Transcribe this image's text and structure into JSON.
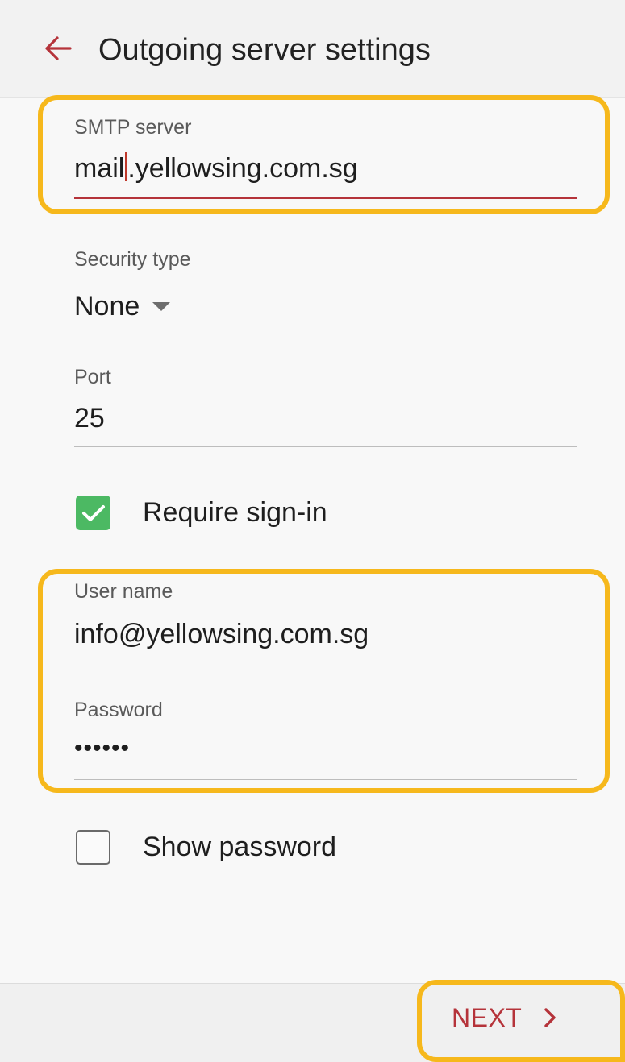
{
  "header": {
    "title": "Outgoing server settings",
    "back_icon": "arrow-left-icon"
  },
  "smtp": {
    "label": "SMTP server",
    "value_before_cursor": "mail",
    "value_after_cursor": ".yellowsing.com.sg"
  },
  "security": {
    "label": "Security type",
    "selected": "None"
  },
  "port": {
    "label": "Port",
    "value": "25"
  },
  "require_signin": {
    "label": "Require sign-in",
    "checked": true
  },
  "username": {
    "label": "User name",
    "value": "info@yellowsing.com.sg"
  },
  "password": {
    "label": "Password",
    "value": "••••••"
  },
  "show_password": {
    "label": "Show password",
    "checked": false
  },
  "footer": {
    "next_label": "NEXT",
    "next_icon": "chevron-right-icon"
  },
  "colors": {
    "accent": "#b5333a",
    "checkbox_checked": "#4cb963",
    "highlight": "#f6b81c"
  }
}
